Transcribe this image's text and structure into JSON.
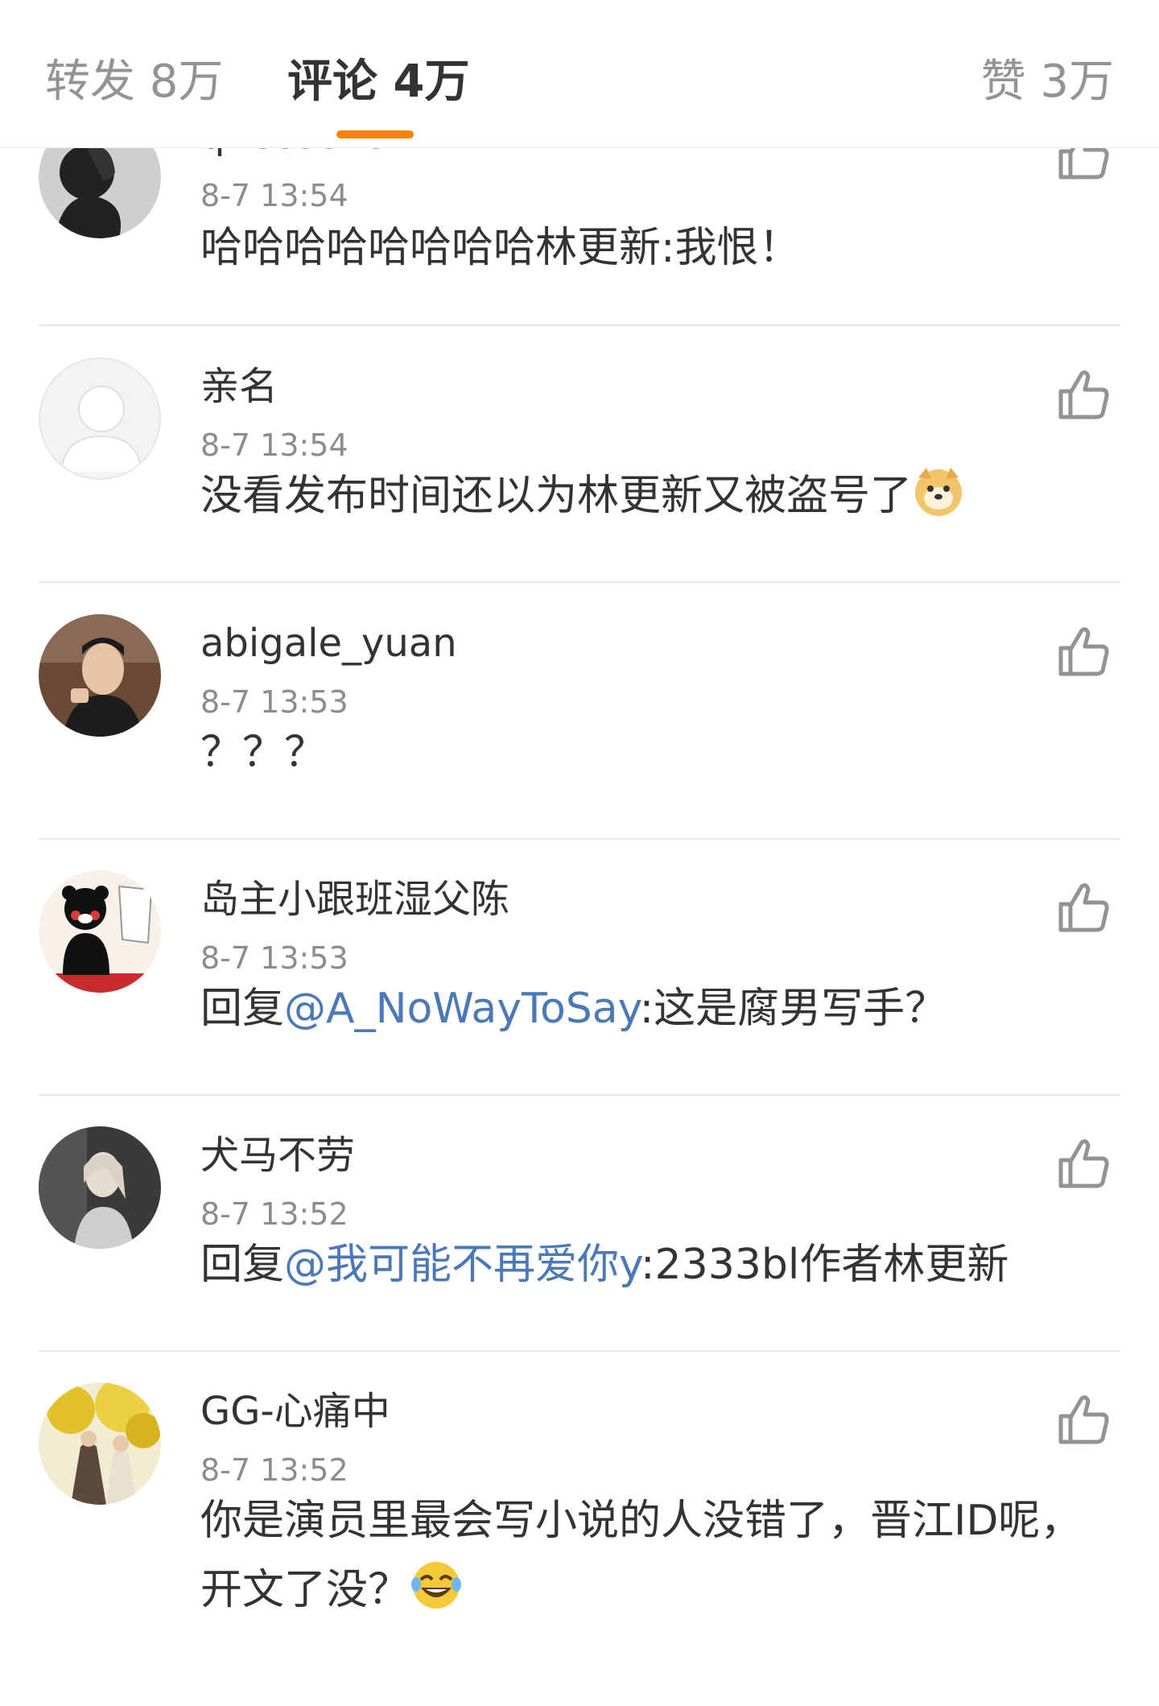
{
  "tabs": {
    "repost": "转发 8万",
    "comment": "评论 4万",
    "like": "赞 3万",
    "accent": "#ff8200"
  },
  "comments": [
    {
      "name": "qASsseven",
      "time": "8-7 13:54",
      "text": "哈哈哈哈哈哈哈哈林更新:我恨！",
      "avatar_icon": "silhouette-avatar-icon"
    },
    {
      "name": "亲名",
      "time": "8-7 13:54",
      "text": "没看发布时间还以为林更新又被盗号了",
      "emoji": "doge-emoji-icon",
      "avatar_icon": "default-avatar-icon"
    },
    {
      "name": "abigale_yuan",
      "time": "8-7 13:53",
      "text": "？？？",
      "avatar_icon": "photo-avatar-icon"
    },
    {
      "name": "岛主小跟班湿父陈",
      "time": "8-7 13:53",
      "reply_prefix": "回复",
      "mention": "@A_NoWayToSay",
      "text": ":这是腐男写手？",
      "avatar_icon": "kumamon-avatar-icon"
    },
    {
      "name": "犬马不劳",
      "time": "8-7 13:52",
      "reply_prefix": "回复",
      "mention": "@我可能不再爱你y",
      "text": ":2333bl作者林更新",
      "avatar_icon": "photo-avatar-icon"
    },
    {
      "name": "GG-心痛中",
      "time": "8-7 13:52",
      "text": "你是演员里最会写小说的人没错了，晋江ID呢，开文了没？",
      "emoji": "laughing-tears-emoji-icon",
      "avatar_icon": "illustration-avatar-icon"
    }
  ],
  "colors": {
    "mention": "#4a78b8",
    "timestamp": "#8c8c8c",
    "icon": "#939393"
  }
}
